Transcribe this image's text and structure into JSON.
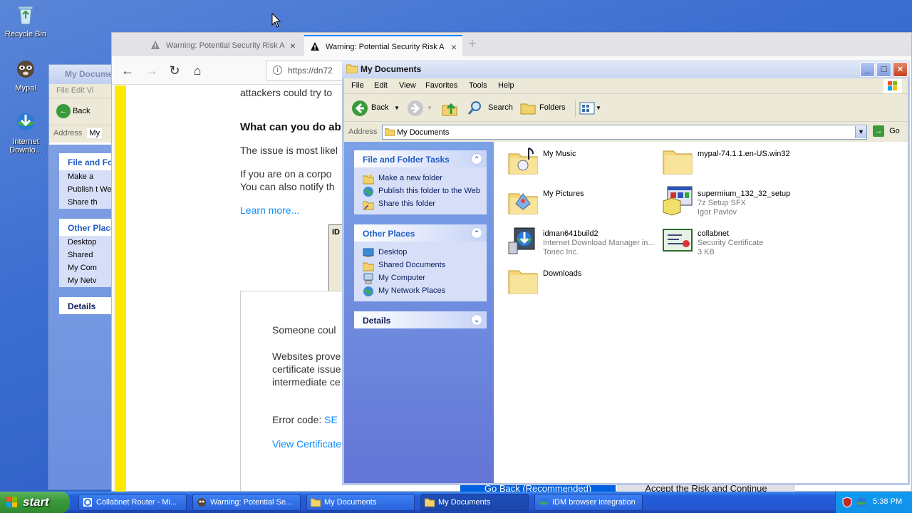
{
  "desktop": {
    "icons": [
      {
        "label": "Recycle Bin",
        "icon": "recycle-bin-icon"
      },
      {
        "label": "Mypal",
        "icon": "mypal-icon"
      },
      {
        "label": "Internet Downlo...",
        "icon": "idm-icon"
      }
    ]
  },
  "bg_explorer": {
    "title": "My Docume",
    "menu": "File  Edit  Vi",
    "back": "Back",
    "address_label": "Address",
    "address_value": "My",
    "panels": [
      {
        "title": "File and Fol",
        "items": [
          "Make a",
          "Publish t Web",
          "Share th"
        ]
      },
      {
        "title": "Other Place",
        "items": [
          "Desktop",
          "Shared",
          "My Com",
          "My Netv"
        ]
      },
      {
        "title": "Details",
        "items": []
      }
    ]
  },
  "firefox": {
    "tabs": [
      {
        "label": "Warning: Potential Security Risk A",
        "active": false
      },
      {
        "label": "Warning: Potential Security Risk A",
        "active": true
      }
    ],
    "new_tab": "+",
    "url": "https://dn72",
    "content": {
      "line1": "attackers could try to",
      "heading": "What can you do ab",
      "p1": "The issue is most likel",
      "p2a": "If you are on a corpo",
      "p2b": "You can also notify th",
      "learn_more": "Learn more...",
      "idm_fragment": "ID",
      "adv1": "Someone coul",
      "adv2a": "Websites prove",
      "adv2b": "certificate issue",
      "adv2c": "intermediate ce",
      "error_label": "Error code:",
      "error_code": "SE",
      "view_cert": "View Certificate"
    },
    "buttons": {
      "go_back": "Go Back (Recommended)",
      "accept": "Accept the Risk and Continue"
    }
  },
  "mydocs": {
    "title": "My Documents",
    "menu": [
      "File",
      "Edit",
      "View",
      "Favorites",
      "Tools",
      "Help"
    ],
    "toolbar": {
      "back": "Back",
      "search": "Search",
      "folders": "Folders"
    },
    "address_label": "Address",
    "address_value": "My Documents",
    "go_label": "Go",
    "tasks": {
      "title": "File and Folder Tasks",
      "items": [
        "Make a new folder",
        "Publish this folder to the Web",
        "Share this folder"
      ]
    },
    "other_places": {
      "title": "Other Places",
      "items": [
        "Desktop",
        "Shared Documents",
        "My Computer",
        "My Network Places"
      ]
    },
    "details": {
      "title": "Details"
    },
    "files": [
      {
        "name": "My Music",
        "sub1": "",
        "sub2": "",
        "icon": "music-folder-icon"
      },
      {
        "name": "mypal-74.1.1.en-US.win32",
        "sub1": "",
        "sub2": "",
        "icon": "folder-icon"
      },
      {
        "name": "My Pictures",
        "sub1": "",
        "sub2": "",
        "icon": "pictures-folder-icon"
      },
      {
        "name": "supermium_132_32_setup",
        "sub1": "7z Setup SFX",
        "sub2": "Igor Pavlov",
        "icon": "installer-icon"
      },
      {
        "name": "idman641build2",
        "sub1": "Internet Download Manager in...",
        "sub2": "Tonec Inc.",
        "icon": "idm-installer-icon"
      },
      {
        "name": "collabnet",
        "sub1": "Security Certificate",
        "sub2": "3 KB",
        "icon": "certificate-icon"
      },
      {
        "name": "Downloads",
        "sub1": "",
        "sub2": "",
        "icon": "folder-icon"
      }
    ]
  },
  "taskbar": {
    "start": "start",
    "items": [
      {
        "label": "Collabnet Router - Mi...",
        "active": false
      },
      {
        "label": "Warning: Potential Se...",
        "active": false
      },
      {
        "label": "My Documents",
        "active": false
      },
      {
        "label": "My Documents",
        "active": true
      },
      {
        "label": "IDM browser integration",
        "active": false
      }
    ],
    "clock": "5:38 PM"
  },
  "colors": {
    "xp_blue": "#245edb",
    "start_green": "#3c9a3c",
    "firefox_warning_yellow": "#ffe900",
    "link_blue": "#0a8dff",
    "task_header_blue": "#215dc6"
  }
}
